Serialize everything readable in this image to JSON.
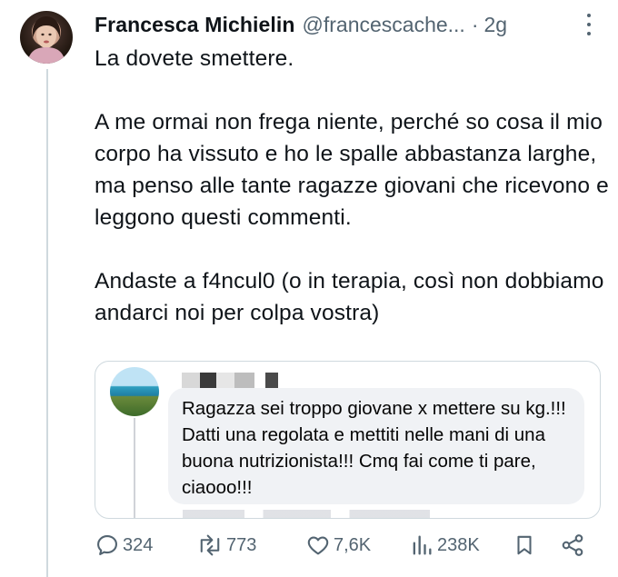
{
  "tweet": {
    "author_name": "Francesca Michielin",
    "author_handle": "@francescache...",
    "separator": "·",
    "time": "2g",
    "paragraphs": [
      "La dovete smettere.",
      "A me ormai non frega niente, perché so cosa il mio corpo ha vissuto e ho le spalle abbastanza larghe, ma penso alle tante ragazze giovani che ricevono e leggono questi commenti.",
      "Andaste a f4ncul0 (o in terapia, così non dobbiamo andarci noi per colpa vostra)"
    ]
  },
  "quoted_comment": {
    "text": "Ragazza sei troppo giovane x mettere su kg.!!! Datti una regolata e mettiti nelle mani di una buona nutrizionista!!! Cmq fai come ti pare, ciaooo!!!"
  },
  "actions": {
    "replies": "324",
    "reposts": "773",
    "likes": "7,6K",
    "views": "238K"
  },
  "colors": {
    "text": "#0f1419",
    "secondary": "#536471",
    "border": "#cfd9de",
    "comment_bubble": "#f0f2f5"
  },
  "icons": [
    "more-icon",
    "reply-icon",
    "repost-icon",
    "like-icon",
    "views-icon",
    "bookmark-icon",
    "share-icon"
  ]
}
